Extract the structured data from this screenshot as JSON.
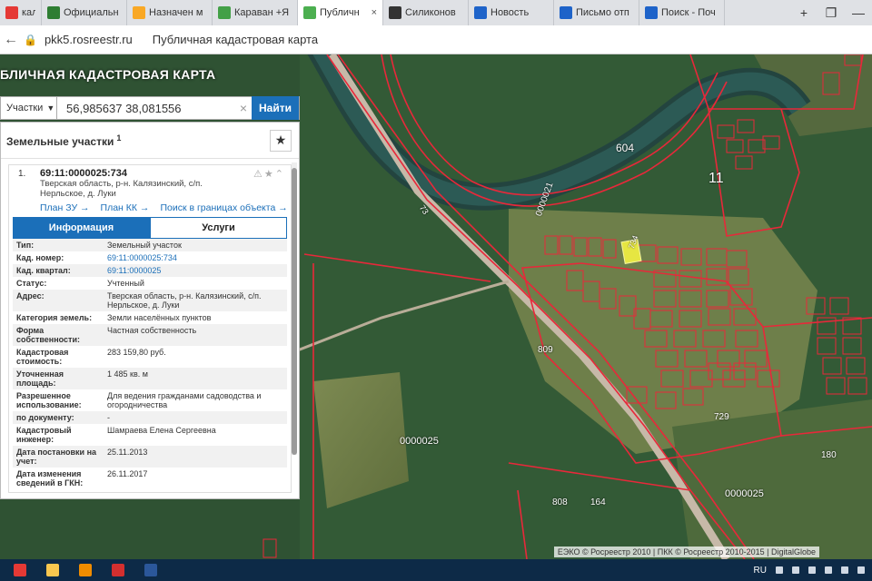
{
  "browser": {
    "tabs": [
      {
        "label": "калин",
        "color": "#e53935",
        "active": false
      },
      {
        "label": "Официальн",
        "color": "#2e7d32",
        "active": false
      },
      {
        "label": "Назначен м",
        "color": "#f9a825",
        "active": false
      },
      {
        "label": "Караван +Я",
        "color": "#43a047",
        "active": false
      },
      {
        "label": "Публичн",
        "color": "#4caf50",
        "active": true
      },
      {
        "label": "Силиконов",
        "color": "#333333",
        "active": false
      },
      {
        "label": "Новость",
        "color": "#1e63c9",
        "active": false
      },
      {
        "label": "Письмо отп",
        "color": "#1e63c9",
        "active": false
      },
      {
        "label": "Поиск - Поч",
        "color": "#1e63c9",
        "active": false
      }
    ],
    "tab_close_glyph": "×",
    "new_tab_glyph": "+",
    "url": "pkk5.rosreestr.ru",
    "page_title": "Публичная кадастровая карта"
  },
  "app": {
    "header": "БЛИЧНАЯ КАДАСТРОВАЯ КАРТА",
    "search": {
      "type_label": "Участки",
      "query": "56,985637 38,081556",
      "button": "Найти",
      "clear_glyph": "×"
    },
    "panel": {
      "title": "Земельные участки",
      "count": "1",
      "result": {
        "index": "1.",
        "cad_number": "69:11:0000025:734",
        "address": "Тверская область, р-н. Калязинский, с/п. Нерльское, д. Луки",
        "links": [
          "План ЗУ →",
          "План КК →",
          "Поиск в границах объекта →"
        ],
        "tabs": [
          "Информация",
          "Услуги"
        ],
        "rows": [
          {
            "k": "Тип:",
            "v": "Земельный участок",
            "link": false
          },
          {
            "k": "Кад. номер:",
            "v": "69:11:0000025:734",
            "link": true
          },
          {
            "k": "Кад. квартал:",
            "v": "69:11:0000025",
            "link": true
          },
          {
            "k": "Статус:",
            "v": "Учтенный",
            "link": false
          },
          {
            "k": "Адрес:",
            "v": "Тверская область, р-н. Калязинский, с/п. Нерльское, д. Луки",
            "link": false
          },
          {
            "k": "Категория земель:",
            "v": "Земли населённых пунктов",
            "link": false
          },
          {
            "k": "Форма собственности:",
            "v": "Частная собственность",
            "link": false
          },
          {
            "k": "Кадастровая стоимость:",
            "v": "283 159,80 руб.",
            "link": false
          },
          {
            "k": "Уточненная площадь:",
            "v": "1 485 кв. м",
            "link": false
          },
          {
            "k": "Разрешенное использование:",
            "v": "Для ведения гражданами садоводства и огородничества",
            "link": false
          },
          {
            "k": "по документу:",
            "v": "-",
            "link": false
          },
          {
            "k": "Кадастровый инженер:",
            "v": "Шамраева Елена Сергеевна",
            "link": false
          },
          {
            "k": "Дата постановки на учет:",
            "v": "25.11.2013",
            "link": false
          },
          {
            "k": "Дата изменения сведений в ГКН:",
            "v": "26.11.2017",
            "link": false
          }
        ]
      }
    }
  },
  "map": {
    "attribution": "ЕЭКО © Росреестр 2010 | ПКК © Росреестр 2010-2015 | DigitalGlobe",
    "labels": [
      {
        "t": "604"
      },
      {
        "t": "11"
      },
      {
        "t": "0000021"
      },
      {
        "t": "0000025"
      },
      {
        "t": "0000025"
      },
      {
        "t": "809"
      },
      {
        "t": "729"
      },
      {
        "t": "808"
      },
      {
        "t": "164"
      },
      {
        "t": "180"
      },
      {
        "t": "73"
      },
      {
        "t": "734"
      }
    ],
    "boundary_color": "#e8283a"
  },
  "taskbar": {
    "lang": "RU"
  }
}
